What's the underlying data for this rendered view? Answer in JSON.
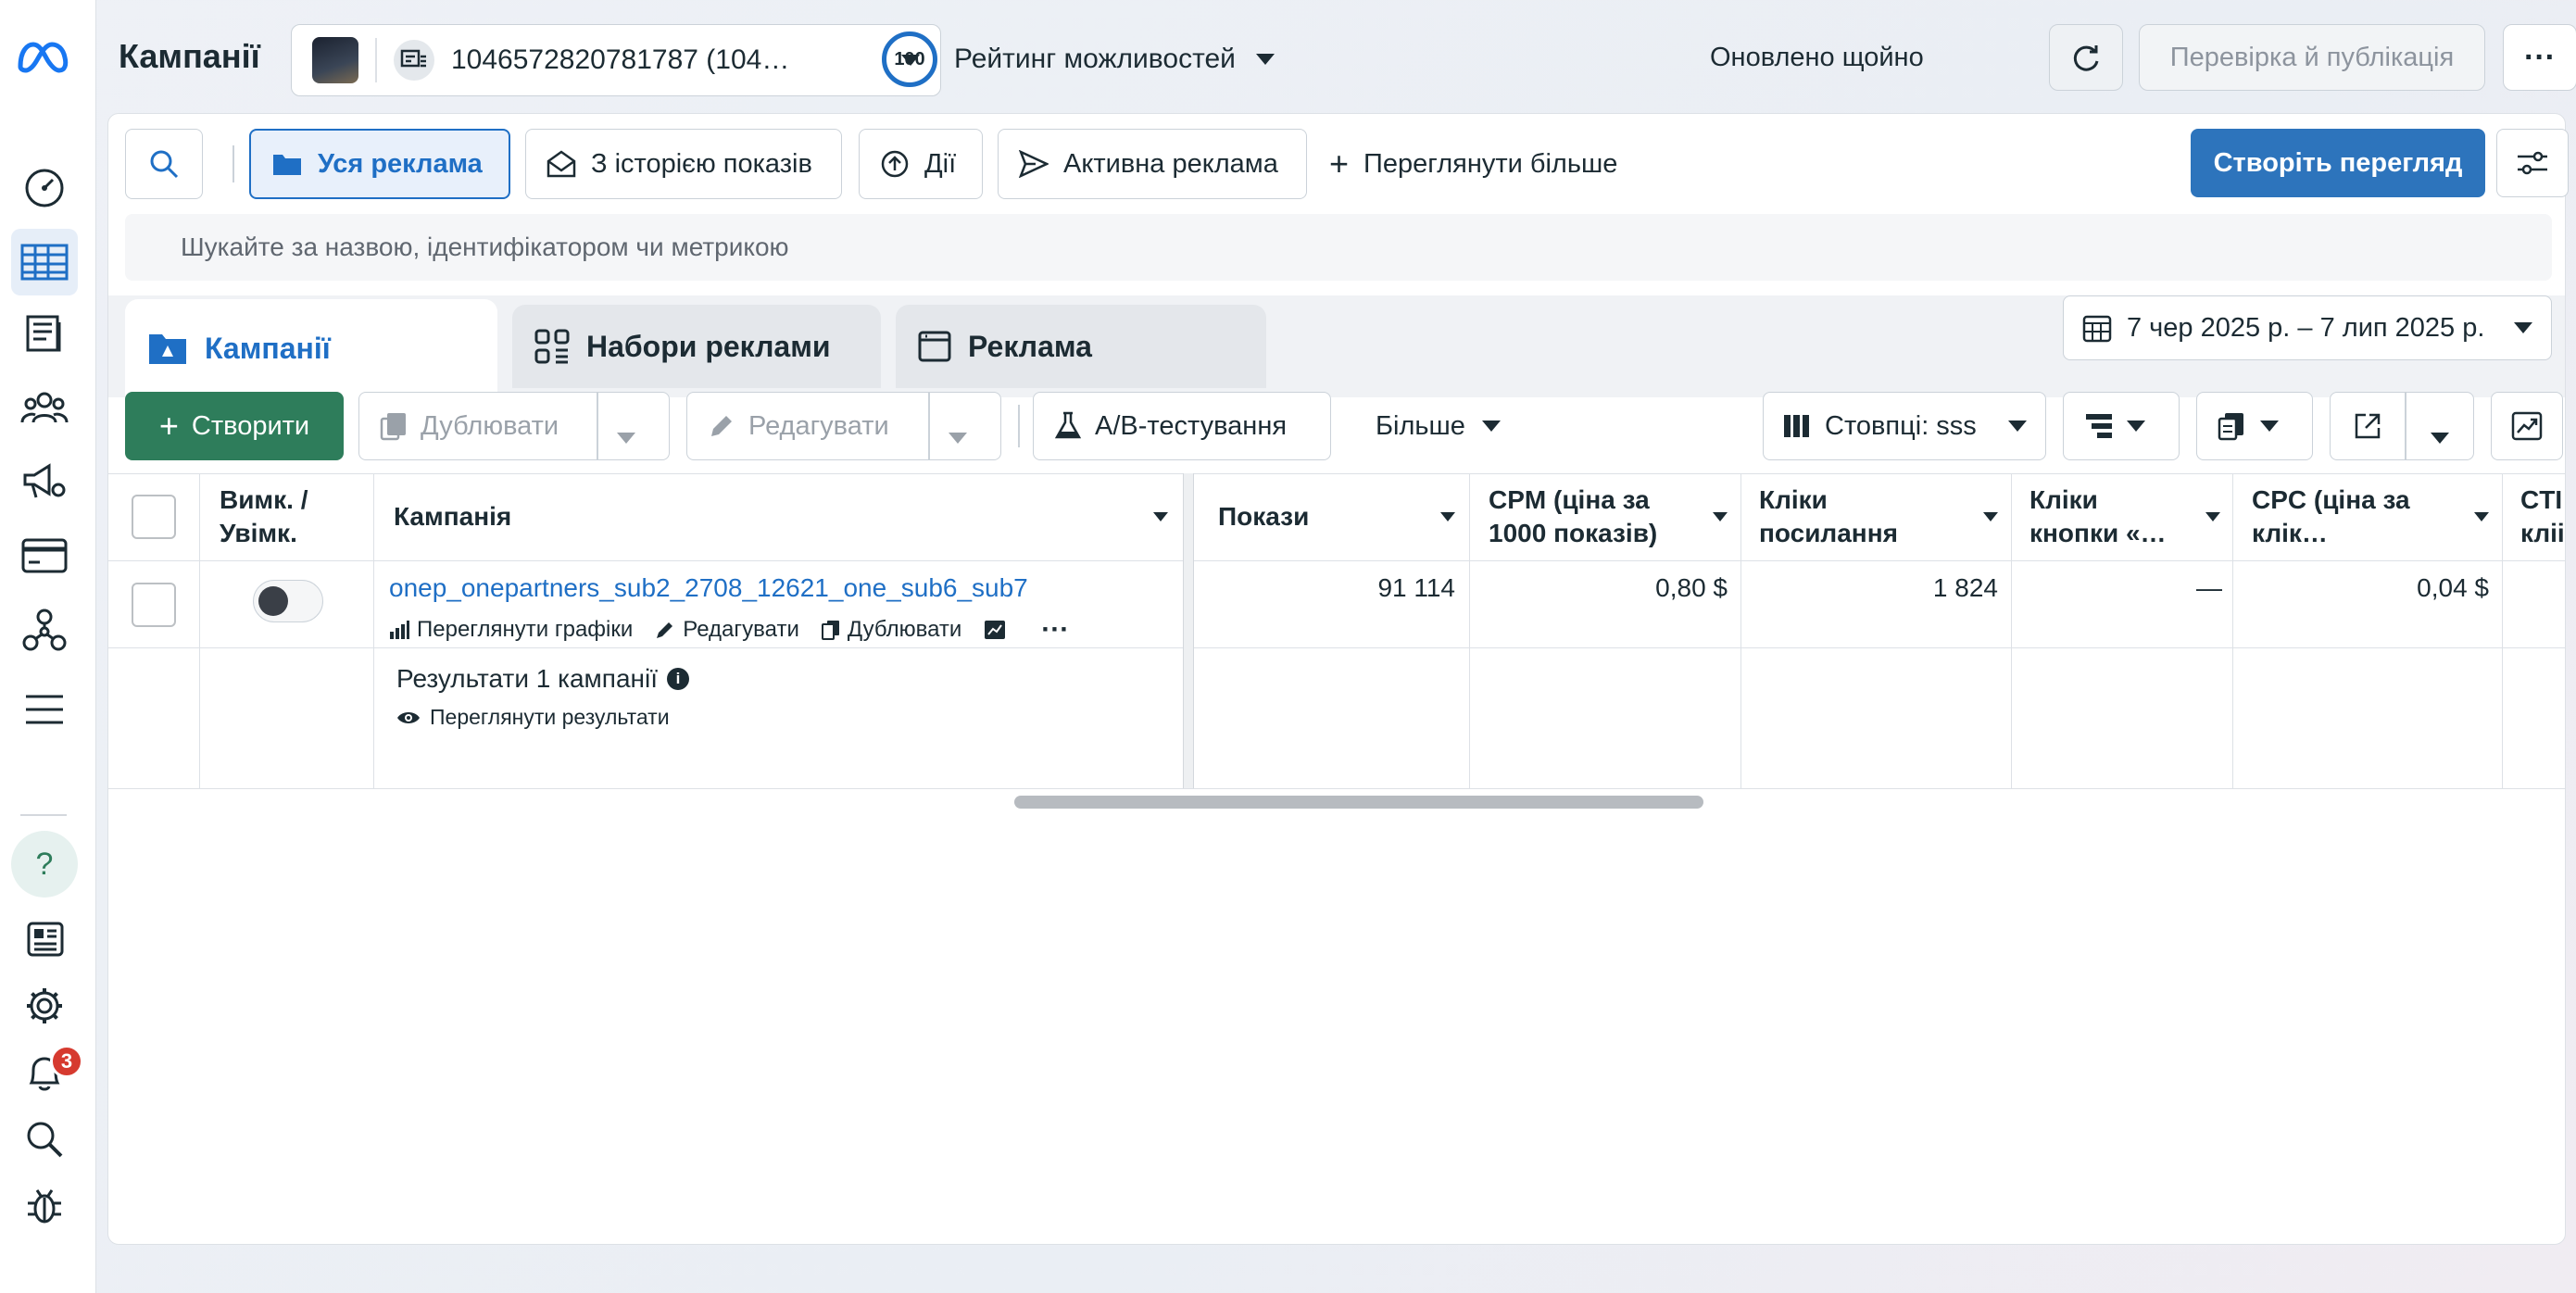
{
  "header": {
    "title": "Кампанії",
    "account_name": "1046572820781787 (104…",
    "rating_score": "100",
    "rating_label": "Рейтинг можливостей",
    "updated_text": "Оновлено щойно",
    "publish_label": "Перевірка й публікація",
    "more_label": "···"
  },
  "filters": {
    "all_ads": "Уся реклама",
    "with_history": "З історією показів",
    "actions": "Дії",
    "active_ads": "Активна реклама",
    "view_more": "Переглянути більше",
    "create_view": "Створіть перегляд"
  },
  "search": {
    "placeholder": "Шукайте за назвою, ідентифікатором чи метрикою"
  },
  "tabs": {
    "campaigns": "Кампанії",
    "ad_sets": "Набори реклами",
    "ads": "Реклама"
  },
  "date_range": "7 чер 2025 р. – 7 лип 2025 р.",
  "toolbar": {
    "create": "Створити",
    "duplicate": "Дублювати",
    "edit": "Редагувати",
    "ab_test": "A/B-тестування",
    "more": "Більше",
    "columns": "Стовпці: sss"
  },
  "table": {
    "headers": {
      "toggle_l1": "Вимк. /",
      "toggle_l2": "Увімк.",
      "campaign": "Кампанія",
      "impressions": "Покази",
      "cpm_l1": "CPM (ціна за",
      "cpm_l2": "1000 показів)",
      "link_clicks_l1": "Кліки",
      "link_clicks_l2": "посилання",
      "button_clicks_l1": "Кліки",
      "button_clicks_l2": "кнопки «…",
      "cpc_l1": "CPC (ціна за",
      "cpc_l2": "клік…",
      "ctr_l1": "CTI",
      "ctr_l2": "кліі"
    },
    "row": {
      "campaign_name": "onep_onepartners_sub2_2708_12621_one_sub6_sub7",
      "view_charts": "Переглянути графіки",
      "edit": "Редагувати",
      "duplicate": "Дублювати",
      "impressions": "91 114",
      "cpm": "0,80 $",
      "link_clicks": "1 824",
      "button_clicks": "—",
      "cpc": "0,04 $"
    },
    "summary": {
      "title": "Результати 1 кампанії",
      "view_results": "Переглянути результати"
    }
  },
  "sidebar": {
    "notification_count": "3"
  },
  "colors": {
    "accent_blue": "#1f6fc5",
    "create_green": "#2e7d5b",
    "badge_red": "#d63a2f"
  }
}
